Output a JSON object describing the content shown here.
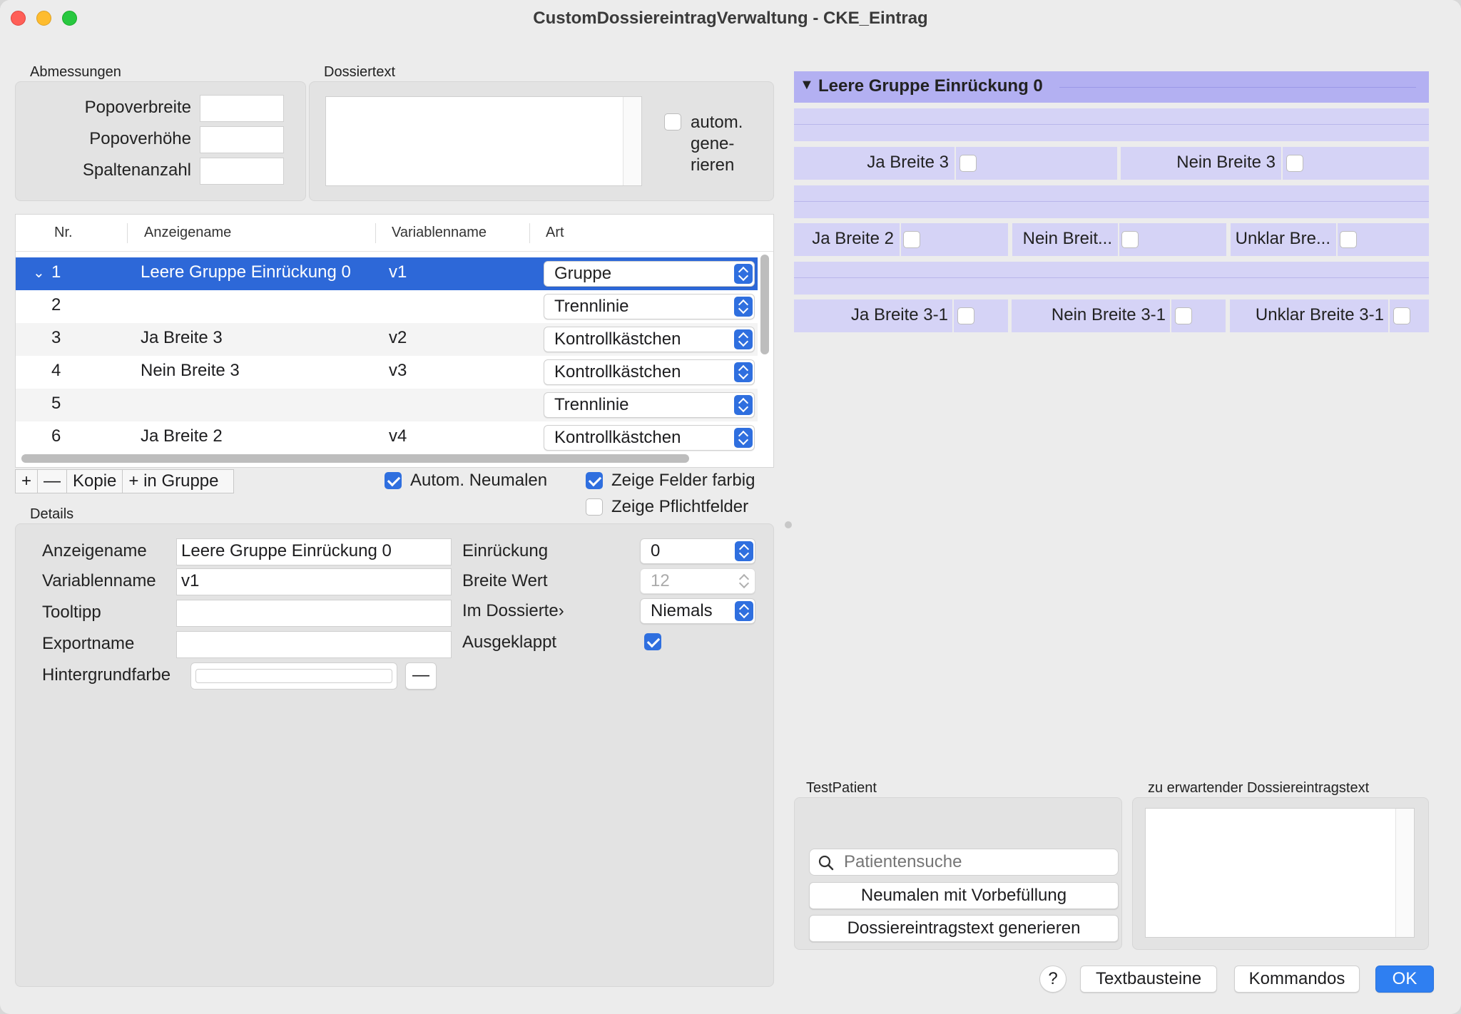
{
  "window": {
    "title": "CustomDossiereintragVerwaltung - CKE_Eintrag"
  },
  "abmessungen": {
    "label": "Abmessungen",
    "popoverbreite": "Popoverbreite",
    "popoverhoehe": "Popoverhöhe",
    "spaltenanzahl": "Spaltenanzahl"
  },
  "dossiertext": {
    "label": "Dossiertext",
    "auto_line1": "autom.",
    "auto_line2": "gene-",
    "auto_line3": "rieren",
    "auto_checked": false
  },
  "table": {
    "headers": {
      "nr": "Nr.",
      "anzeigename": "Anzeigename",
      "variablenname": "Variablenname",
      "art": "Art"
    },
    "rows": [
      {
        "nr": "1",
        "name": "Leere Gruppe Einrückung 0",
        "var": "v1",
        "art": "Gruppe"
      },
      {
        "nr": "2",
        "name": "",
        "var": "",
        "art": "Trennlinie"
      },
      {
        "nr": "3",
        "name": "Ja Breite 3",
        "var": "v2",
        "art": "Kontrollkästchen"
      },
      {
        "nr": "4",
        "name": "Nein Breite 3",
        "var": "v3",
        "art": "Kontrollkästchen"
      },
      {
        "nr": "5",
        "name": "",
        "var": "",
        "art": "Trennlinie"
      },
      {
        "nr": "6",
        "name": "Ja Breite 2",
        "var": "v4",
        "art": "Kontrollkästchen"
      }
    ]
  },
  "toolbar": {
    "add": "+",
    "remove": "—",
    "copy": "Kopie",
    "add_in_group": "+ in Gruppe",
    "auto_repaint": "Autom. Neumalen",
    "show_colored": "Zeige Felder farbig",
    "show_required": "Zeige Pflichtfelder"
  },
  "details": {
    "label": "Details",
    "anzeigename_label": "Anzeigename",
    "anzeigename_value": "Leere Gruppe Einrückung 0",
    "variablenname_label": "Variablenname",
    "variablenname_value": "v1",
    "tooltipp_label": "Tooltipp",
    "exportname_label": "Exportname",
    "hintergrundfarbe_label": "Hintergrundfarbe",
    "color_remove": "—",
    "einrueckung_label": "Einrückung",
    "einrueckung_value": "0",
    "breite_label": "Breite Wert",
    "breite_value": "12",
    "im_dossier_label": "Im Dossierte›",
    "im_dossier_value": "Niemals",
    "ausgeklappt_label": "Ausgeklappt"
  },
  "preview": {
    "group_title": "Leere Gruppe Einrückung 0",
    "row1": [
      "Ja Breite 3",
      "Nein Breite 3"
    ],
    "row2": [
      "Ja Breite 2",
      "Nein Breit...",
      "Unklar Bre..."
    ],
    "row3": [
      "Ja Breite 3-1",
      "Nein Breite 3-1",
      "Unklar Breite 3-1"
    ]
  },
  "testpatient": {
    "label": "TestPatient",
    "search_placeholder": "Patientensuche",
    "repaint_button": "Neumalen mit Vorbefüllung",
    "generate_button": "Dossiereintragstext generieren"
  },
  "expected": {
    "label": "zu erwartender Dossiereintragstext"
  },
  "footer": {
    "help": "?",
    "textbausteine": "Textbausteine",
    "kommandos": "Kommandos",
    "ok": "OK"
  },
  "colors": {
    "accent": "#2f6fdf",
    "selection": "#2d68d8",
    "preview_bg": "#d5d3f6",
    "preview_header": "#b3b0f2"
  }
}
